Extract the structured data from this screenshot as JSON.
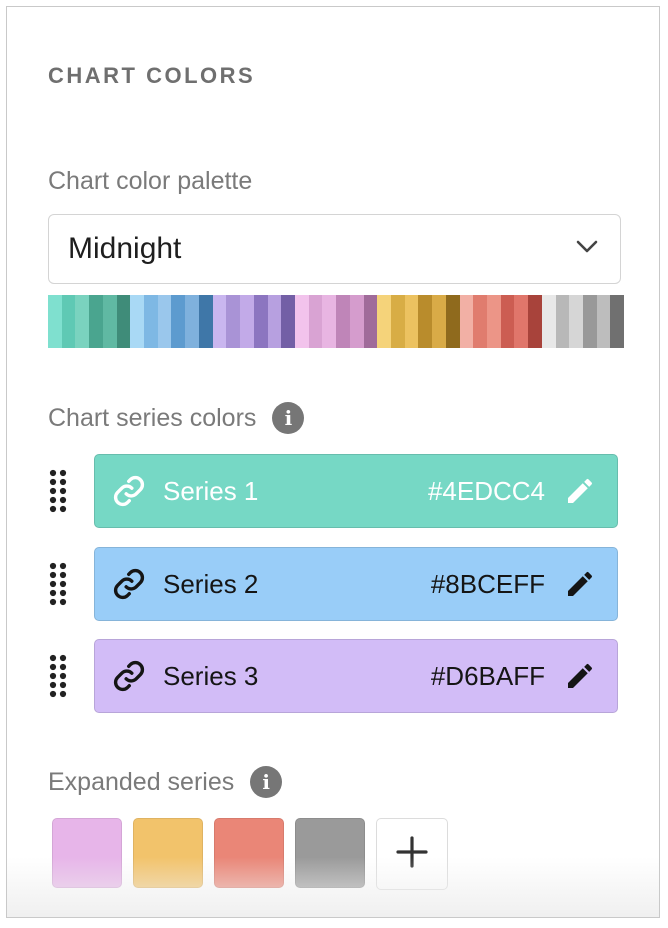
{
  "panel": {
    "section_title": "CHART COLORS",
    "palette_label": "Chart color palette",
    "palette_selected": "Midnight",
    "palette_strip_colors": [
      "#7fe0cf",
      "#5fc9b4",
      "#7ad3bf",
      "#4aa58f",
      "#60b9a3",
      "#3f8c79",
      "#a9d9f5",
      "#7eb8e4",
      "#9ac7ec",
      "#5d9bcf",
      "#7fb1dd",
      "#3f77a8",
      "#c9b6ef",
      "#a993d6",
      "#c2aae8",
      "#8c75c0",
      "#b7a0e0",
      "#735fa6",
      "#f2c3ec",
      "#d9a3d3",
      "#e8b5e2",
      "#bf85b8",
      "#d59ccd",
      "#a06b9a",
      "#f5d37a",
      "#d8ad45",
      "#ecc260",
      "#b98c2c",
      "#d9ab47",
      "#8f6a1d",
      "#f2b0a5",
      "#e07c6e",
      "#ec9587",
      "#cc5d52",
      "#e0766b",
      "#a8433b",
      "#e8e8e8",
      "#b8b8b8",
      "#d6d6d6",
      "#999999",
      "#bdbdbd",
      "#707070"
    ],
    "series_label": "Chart series colors",
    "series": [
      {
        "name": "Series 1",
        "hex": "#4EDCC4",
        "fill": "#76d8c5",
        "text": "light"
      },
      {
        "name": "Series 2",
        "hex": "#8BCEFF",
        "fill": "#99cdf8",
        "text": "dark"
      },
      {
        "name": "Series 3",
        "hex": "#D6BAFF",
        "fill": "#d2bcf7",
        "text": "dark"
      }
    ],
    "expanded_label": "Expanded series",
    "expanded_colors": [
      "#e7b5e9",
      "#f2c36b",
      "#ea8677",
      "#9a9a9a"
    ],
    "icons": {
      "dropdown": "chevron-down-icon",
      "info": "info-icon",
      "drag": "drag-handle-icon",
      "link": "link-icon",
      "edit": "pencil-icon",
      "add": "plus-icon"
    }
  }
}
